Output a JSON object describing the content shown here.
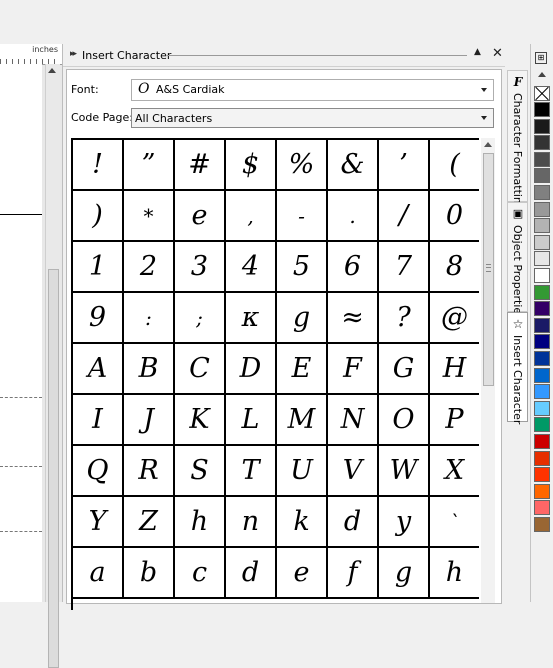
{
  "ruler": {
    "units": "inches"
  },
  "docker": {
    "title": "Insert Character",
    "font_label": "Font:",
    "font_value": "A&S Cardiak",
    "font_icon": "O",
    "codepage_label": "Code Page:",
    "codepage_value": "All Characters"
  },
  "characters": [
    "!",
    "”",
    "#",
    "$",
    "%",
    "&",
    "’",
    "(",
    ")",
    "*",
    "e",
    ",",
    "-",
    ".",
    "/",
    "0",
    "1",
    "2",
    "3",
    "4",
    "5",
    "6",
    "7",
    "8",
    "9",
    ":",
    ";",
    "κ",
    "g",
    "≈",
    "?",
    "@",
    "A",
    "B",
    "C",
    "D",
    "E",
    "F",
    "G",
    "H",
    "I",
    "J",
    "K",
    "L",
    "M",
    "N",
    "O",
    "P",
    "Q",
    "R",
    "S",
    "T",
    "U",
    "V",
    "W",
    "X",
    "Y",
    "Z",
    "h",
    "n",
    "k",
    "d",
    "y",
    "`",
    "a",
    "b",
    "c",
    "d",
    "e",
    "f",
    "g",
    "h"
  ],
  "tabs": [
    {
      "label": "Character Formatting",
      "icon": "character-formatting-icon"
    },
    {
      "label": "Object Properties",
      "icon": "object-properties-icon"
    },
    {
      "label": "Insert Character",
      "icon": "star-icon"
    }
  ],
  "palette": [
    "#000000",
    "#1a1a1a",
    "#333333",
    "#4d4d4d",
    "#666666",
    "#808080",
    "#999999",
    "#b3b3b3",
    "#cccccc",
    "#e6e6e6",
    "#ffffff",
    "#339933",
    "#330066",
    "#1a1a66",
    "#000080",
    "#003399",
    "#0066cc",
    "#3399ff",
    "#66ccff",
    "#009966",
    "#cc0000",
    "#e62e00",
    "#ff3300",
    "#ff6600",
    "#ff6666",
    "#996633"
  ]
}
